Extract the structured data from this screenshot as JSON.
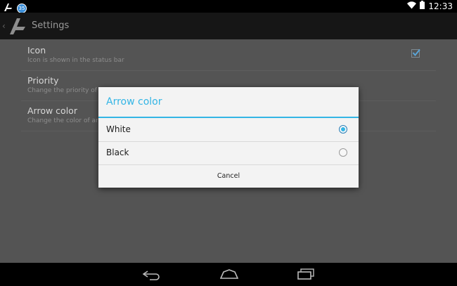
{
  "status_bar": {
    "notification_badge": "35",
    "time": "12:33",
    "icons": [
      "app-notification-icon",
      "badge-icon",
      "wifi-icon",
      "battery-icon"
    ]
  },
  "action_bar": {
    "title": "Settings"
  },
  "preferences": [
    {
      "title": "Icon",
      "summary": "Icon is shown in the status bar",
      "checked": true
    },
    {
      "title": "Priority",
      "summary": "Change the priority of t"
    },
    {
      "title": "Arrow color",
      "summary": "Change the color of arr"
    }
  ],
  "dialog": {
    "title": "Arrow color",
    "options": [
      {
        "label": "White",
        "selected": true
      },
      {
        "label": "Black",
        "selected": false
      }
    ],
    "cancel_label": "Cancel"
  },
  "nav_bar": {
    "buttons": [
      "back-icon",
      "home-icon",
      "recents-icon"
    ]
  },
  "colors": {
    "accent": "#33b5e5",
    "dialog_bg": "#f3f3f3",
    "scrim_bg": "#545454",
    "action_bar_bg": "#161616"
  }
}
